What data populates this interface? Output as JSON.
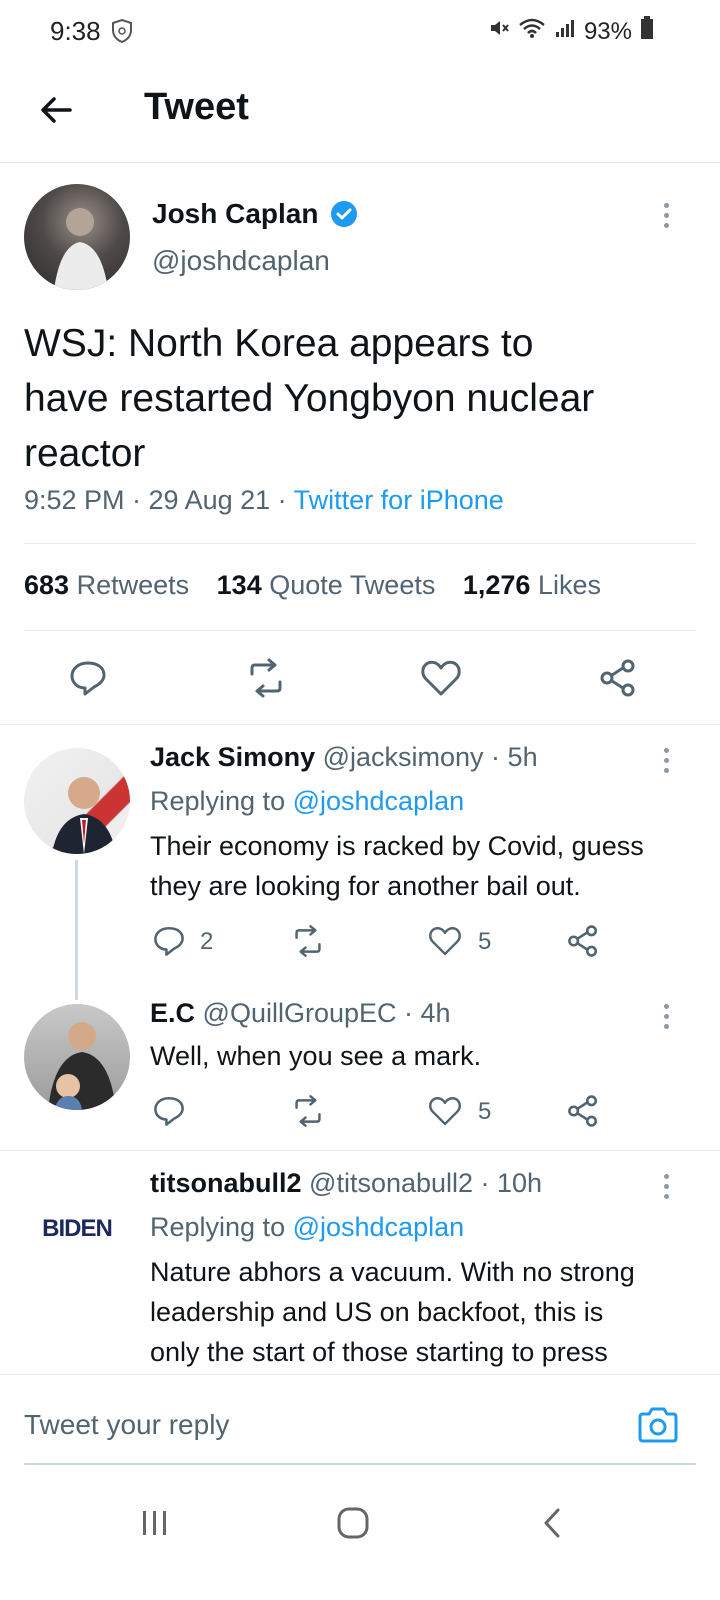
{
  "status_bar": {
    "time": "9:38",
    "battery": "93%"
  },
  "header": {
    "title": "Tweet"
  },
  "tweet": {
    "author_name": "Josh Caplan",
    "author_handle": "@joshdcaplan",
    "text_lines": [
      "WSJ: North Korea appears to",
      "have restarted Yongbyon nuclear",
      "reactor"
    ],
    "timestamp": "9:52 PM · 29 Aug 21 · ",
    "source": "Twitter for iPhone",
    "stats": {
      "retweets_count": "683",
      "retweets_label": "Retweets",
      "quotes_count": "134",
      "quotes_label": "Quote Tweets",
      "likes_count": "1,276",
      "likes_label": "Likes"
    }
  },
  "replies": [
    {
      "name": "Jack Simony",
      "handle_time": "@jacksimony · 5h",
      "replying_prefix": "Replying to ",
      "replying_to": "@joshdcaplan",
      "text_lines": [
        "Their economy is racked by Covid, guess",
        "they are looking for another bail out."
      ],
      "reply_count": "2",
      "like_count": "5"
    },
    {
      "name": "E.C",
      "handle_time": "@QuillGroupEC · 4h",
      "text_lines": [
        "Well, when you see a mark."
      ],
      "reply_count": "",
      "like_count": "5"
    },
    {
      "name": "titsonabull2",
      "handle_time": "@titsonabull2 · 10h",
      "replying_prefix": "Replying to ",
      "replying_to": "@joshdcaplan",
      "avatar_text": "BIDEN",
      "text_lines": [
        "Nature abhors a vacuum. With no strong",
        "leadership and US on backfoot, this is",
        "only the start of those starting to press"
      ]
    }
  ],
  "compose": {
    "placeholder": "Tweet your reply"
  },
  "colors": {
    "accent": "#1d9bf0",
    "muted": "#536471",
    "text": "#0f1419"
  }
}
